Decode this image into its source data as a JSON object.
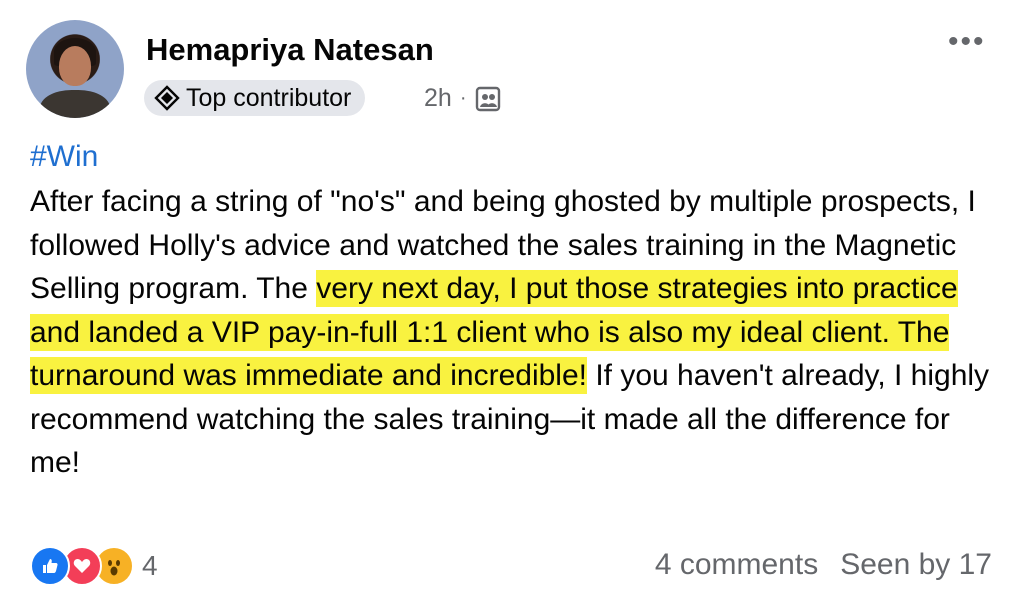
{
  "post": {
    "author": "Hemapriya Natesan",
    "badge_label": "Top contributor",
    "time": "2h",
    "separator": "·",
    "hashtag": "#Win",
    "text_part1": "After facing a string of \"no's\" and being ghosted by multiple prospects, I followed Holly's advice and watched the sales training in the Magnetic Selling program. The ",
    "text_highlight": "very next day, I put those strategies into practice and landed a VIP pay-in-full 1:1 client who is also my ideal client. The turnaround was immediate and incredible!",
    "text_part2": " If you haven't already, I highly recommend watching the sales training—it made all the difference for me!",
    "highlight_color": "#f8f01e",
    "hashtag_color": "#1f6fd0"
  },
  "footer": {
    "reaction_icons": [
      "like-icon",
      "love-icon",
      "wow-icon"
    ],
    "reaction_count": "4",
    "comments": "4 comments",
    "seen_by": "Seen by 17"
  },
  "icons": {
    "more": "more-options-icon",
    "badge": "top-contributor-badge-icon",
    "audience": "group-audience-icon"
  }
}
